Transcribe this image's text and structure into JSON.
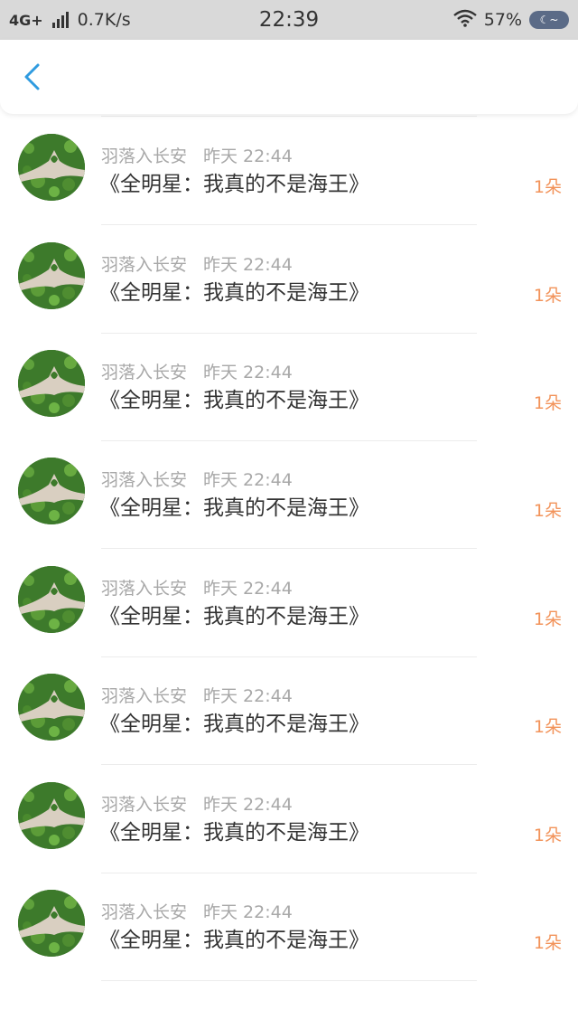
{
  "status_bar": {
    "network": "4G+",
    "speed": "0.7K/s",
    "time": "22:39",
    "battery": "57%"
  },
  "nav": {
    "back_icon": "chevron-left-icon",
    "accent": "#2f9be0"
  },
  "list": {
    "items": [
      {
        "user": "",
        "time": "",
        "message": "《全明星：我真的不是海王》",
        "flowers": "1朵"
      },
      {
        "user": "羽落入长安",
        "time": "昨天 22:44",
        "message": "《全明星：我真的不是海王》",
        "flowers": "1朵"
      },
      {
        "user": "羽落入长安",
        "time": "昨天 22:44",
        "message": "《全明星：我真的不是海王》",
        "flowers": "1朵"
      },
      {
        "user": "羽落入长安",
        "time": "昨天 22:44",
        "message": "《全明星：我真的不是海王》",
        "flowers": "1朵"
      },
      {
        "user": "羽落入长安",
        "time": "昨天 22:44",
        "message": "《全明星：我真的不是海王》",
        "flowers": "1朵"
      },
      {
        "user": "羽落入长安",
        "time": "昨天 22:44",
        "message": "《全明星：我真的不是海王》",
        "flowers": "1朵"
      },
      {
        "user": "羽落入长安",
        "time": "昨天 22:44",
        "message": "《全明星：我真的不是海王》",
        "flowers": "1朵"
      },
      {
        "user": "羽落入长安",
        "time": "昨天 22:44",
        "message": "《全明星：我真的不是海王》",
        "flowers": "1朵"
      },
      {
        "user": "羽落入长安",
        "time": "昨天 22:44",
        "message": "《全明星：我真的不是海王》",
        "flowers": "1朵"
      }
    ]
  },
  "colors": {
    "flower_text": "#f2935a",
    "meta_text": "#a8a8a8"
  }
}
